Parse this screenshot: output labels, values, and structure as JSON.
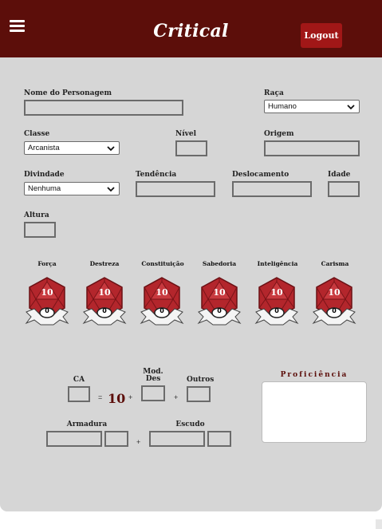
{
  "header": {
    "brand": "Critical",
    "logout_label": "Logout"
  },
  "form": {
    "nome_label": "Nome do Personagem",
    "raca_label": "Raça",
    "raca_value": "Humano",
    "classe_label": "Classe",
    "classe_value": "Arcanista",
    "nivel_label": "Nível",
    "origem_label": "Origem",
    "divindade_label": "Divindade",
    "divindade_value": "Nenhuma",
    "tendencia_label": "Tendência",
    "deslocamento_label": "Deslocamento",
    "idade_label": "Idade",
    "altura_label": "Altura"
  },
  "attributes": [
    {
      "label": "Força",
      "value": "10",
      "modifier": "0"
    },
    {
      "label": "Destreza",
      "value": "10",
      "modifier": "0"
    },
    {
      "label": "Constituição",
      "value": "10",
      "modifier": "0"
    },
    {
      "label": "Sabedoria",
      "value": "10",
      "modifier": "0"
    },
    {
      "label": "Inteligência",
      "value": "10",
      "modifier": "0"
    },
    {
      "label": "Carisma",
      "value": "10",
      "modifier": "0"
    }
  ],
  "defense": {
    "ca_label": "CA",
    "equals": "=",
    "ca_value": "10",
    "plus": "+",
    "mod_des_label_1": "Mod.",
    "mod_des_label_2": "Des",
    "outros_label": "Outros",
    "armadura_label": "Armadura",
    "escudo_label": "Escudo"
  },
  "proficiencia_label": "Proficiência",
  "colors": {
    "header": "#5c0e0a",
    "button": "#a11717",
    "die": "#b3262c",
    "background": "#d6d6d6"
  },
  "icons": {
    "menu": "hamburger-icon",
    "dropdown": "chevron-down-icon",
    "die": "d20-icon"
  }
}
